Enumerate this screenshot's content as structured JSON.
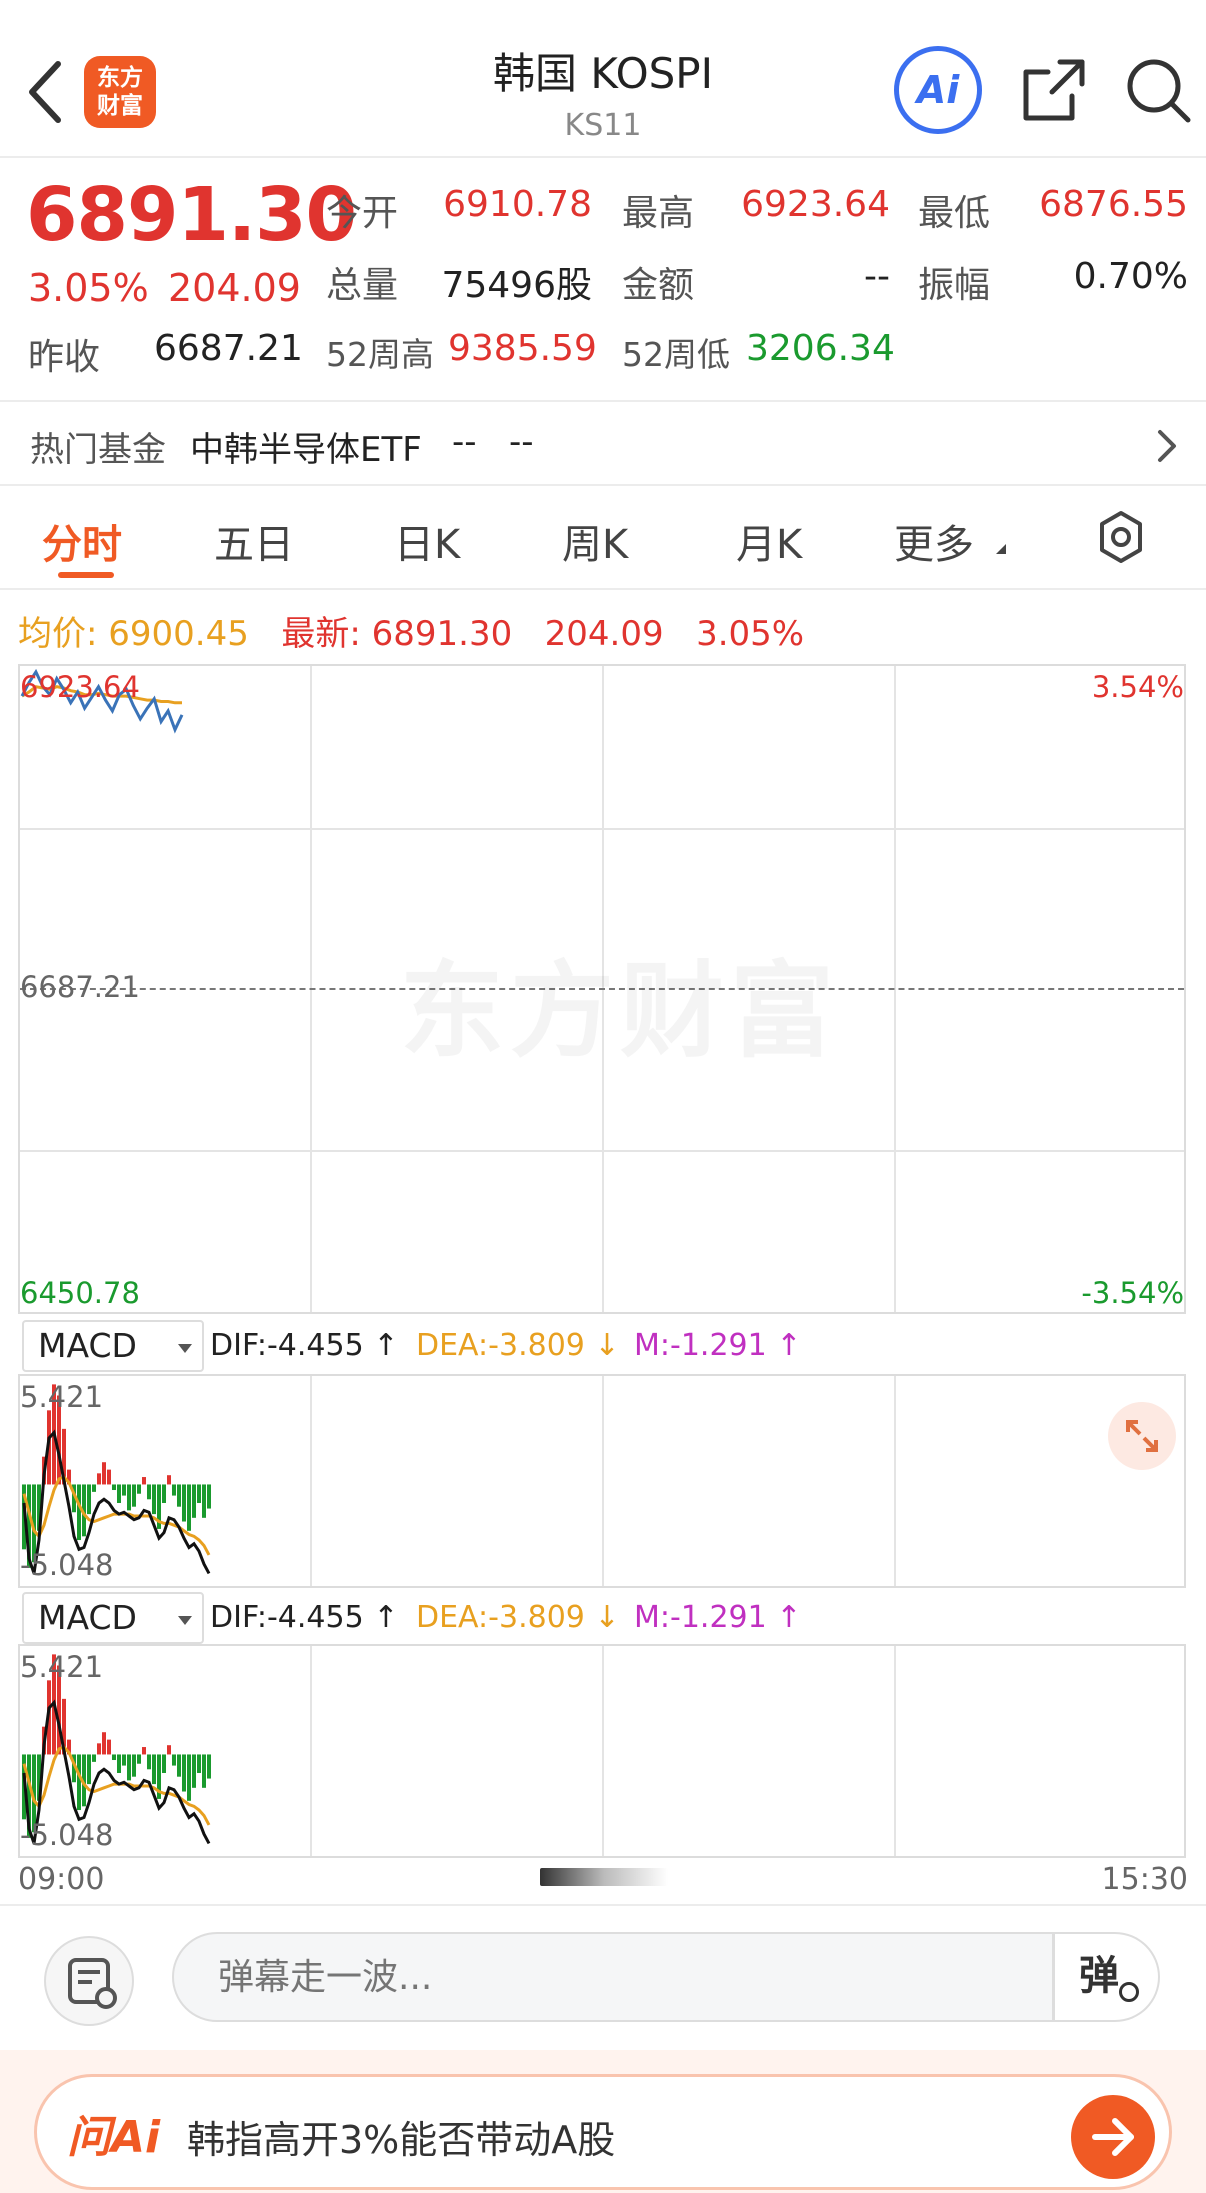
{
  "header": {
    "logo_line1": "东方",
    "logo_line2": "财富",
    "title": "韩国 KOSPI",
    "code": "KS11",
    "ai_label": "Ai"
  },
  "quote": {
    "price": "6891.30",
    "change_pct": "3.05%",
    "change_abs": "204.09",
    "prev_close_label": "昨收",
    "prev_close": "6687.21",
    "open_label": "今开",
    "open": "6910.78",
    "high_label": "最高",
    "high": "6923.64",
    "low_label": "最低",
    "low": "6876.55",
    "volume_label": "总量",
    "volume": "75496股",
    "amount_label": "金额",
    "amount": "--",
    "amplitude_label": "振幅",
    "amplitude": "0.70%",
    "wk52_high_label": "52周高",
    "wk52_high": "9385.59",
    "wk52_low_label": "52周低",
    "wk52_low": "3206.34"
  },
  "fund": {
    "label": "热门基金",
    "name": "中韩半导体ETF",
    "value1": "--",
    "value2": "--"
  },
  "tabs": [
    "分时",
    "五日",
    "日K",
    "周K",
    "月K",
    "更多"
  ],
  "summary": {
    "avg_label": "均价:",
    "avg_value": "6900.45",
    "latest_label": "最新:",
    "latest_value": "6891.30",
    "latest_change": "204.09",
    "latest_pct": "3.05%"
  },
  "intraday": {
    "top_price": "6923.64",
    "mid_price": "6687.21",
    "bottom_price": "6450.78",
    "top_pct": "3.54%",
    "bottom_pct": "-3.54%",
    "watermark": "东方财富",
    "colors": {
      "price_line": "#3a73b8",
      "avg_line": "#e8a020"
    },
    "price_series": [
      6905,
      6915,
      6923,
      6912,
      6906,
      6918,
      6910,
      6900,
      6908,
      6896,
      6904,
      6912,
      6902,
      6894,
      6906,
      6910,
      6898,
      6888,
      6896,
      6903,
      6886,
      6894,
      6880,
      6891
    ],
    "avg_series": [
      6905,
      6908,
      6912,
      6911,
      6910,
      6912,
      6911,
      6909,
      6908,
      6906,
      6906,
      6907,
      6906,
      6905,
      6905,
      6905,
      6904,
      6903,
      6902,
      6902,
      6901,
      6901,
      6900,
      6900
    ]
  },
  "macd": [
    {
      "selector": "MACD",
      "dif": "DIF:-4.455 ↑",
      "dea": "DEA:-3.809 ↓",
      "m": "M:-1.291 ↑",
      "top": "5.421",
      "bottom": "-5.048"
    },
    {
      "selector": "MACD",
      "dif": "DIF:-4.455 ↑",
      "dea": "DEA:-3.809 ↓",
      "m": "M:-1.291 ↑",
      "top": "5.421",
      "bottom": "-5.048"
    }
  ],
  "macd_series": {
    "colors": {
      "up": "#e0342f",
      "down": "#1a9a2e",
      "dif": "#111111",
      "dea": "#e8a020",
      "m": "#c030c0"
    },
    "bars": [
      -3.5,
      -4.5,
      -4.2,
      -2.5,
      1.5,
      4.0,
      5.4,
      4.8,
      3.0,
      0.8,
      -1.5,
      -3.0,
      -2.8,
      -1.6,
      -0.4,
      0.6,
      1.2,
      0.8,
      -0.3,
      -1.0,
      -0.6,
      -1.4,
      -1.2,
      -0.5,
      0.4,
      -0.8,
      -1.6,
      -2.4,
      -1.0,
      0.5,
      -0.6,
      -1.2,
      -2.0,
      -2.5,
      -1.8,
      -1.0,
      -1.8,
      -1.3
    ],
    "dif": [
      -1.0,
      -4.0,
      -4.8,
      -3.0,
      0.5,
      2.5,
      2.8,
      1.6,
      0.2,
      -1.2,
      -2.8,
      -3.5,
      -3.4,
      -2.6,
      -1.6,
      -1.0,
      -0.8,
      -1.0,
      -1.4,
      -1.6,
      -1.5,
      -1.7,
      -1.9,
      -1.8,
      -1.4,
      -1.5,
      -2.2,
      -2.9,
      -2.6,
      -1.8,
      -1.9,
      -2.3,
      -2.9,
      -3.4,
      -3.2,
      -3.6,
      -4.3,
      -4.8
    ],
    "dea": [
      -0.5,
      -1.5,
      -2.5,
      -2.8,
      -2.2,
      -1.2,
      -0.3,
      0.3,
      0.4,
      0.1,
      -0.5,
      -1.1,
      -1.6,
      -1.9,
      -2.0,
      -1.9,
      -1.8,
      -1.7,
      -1.6,
      -1.6,
      -1.6,
      -1.6,
      -1.7,
      -1.7,
      -1.7,
      -1.7,
      -1.8,
      -2.0,
      -2.1,
      -2.1,
      -2.2,
      -2.3,
      -2.5,
      -2.7,
      -2.8,
      -3.0,
      -3.3,
      -3.8
    ]
  },
  "time_axis": {
    "start": "09:00",
    "end": "15:30"
  },
  "danmu": {
    "placeholder": "弹幕走一波...",
    "toggle_label": "弹"
  },
  "ask": {
    "logo": "问Ai",
    "question": "韩指高开3%能否带动A股"
  }
}
